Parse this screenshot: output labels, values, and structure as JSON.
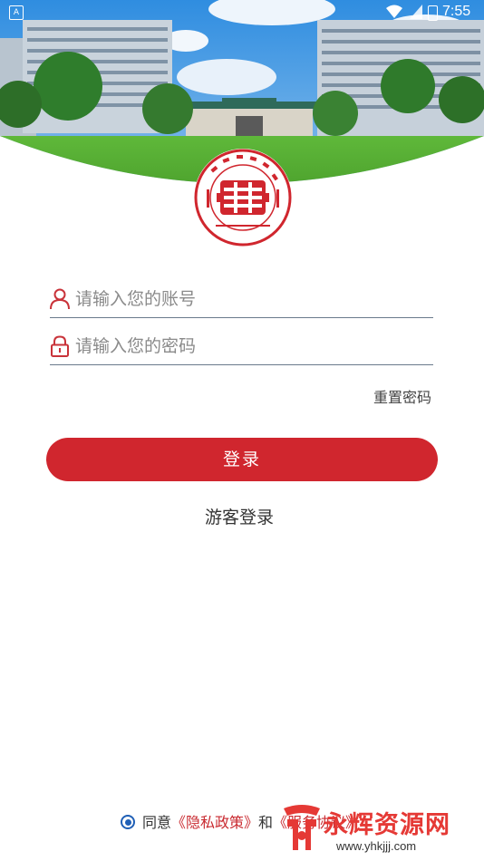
{
  "status_bar": {
    "time": "7:55"
  },
  "login": {
    "account_placeholder": "请输入您的账号",
    "password_placeholder": "请输入您的密码",
    "reset_password": "重置密码",
    "login_button": "登录",
    "guest_login": "游客登录"
  },
  "agreement": {
    "agree_text": "同意",
    "privacy_policy": "《隐私政策》",
    "and_text": "和",
    "service_agreement": "《服务协议》"
  },
  "watermark": {
    "title": "永辉资源网",
    "url": "www.yhkjjj.com"
  },
  "colors": {
    "primary": "#d0262e",
    "radio": "#1f5fb6",
    "underline": "#6a7a8c"
  }
}
